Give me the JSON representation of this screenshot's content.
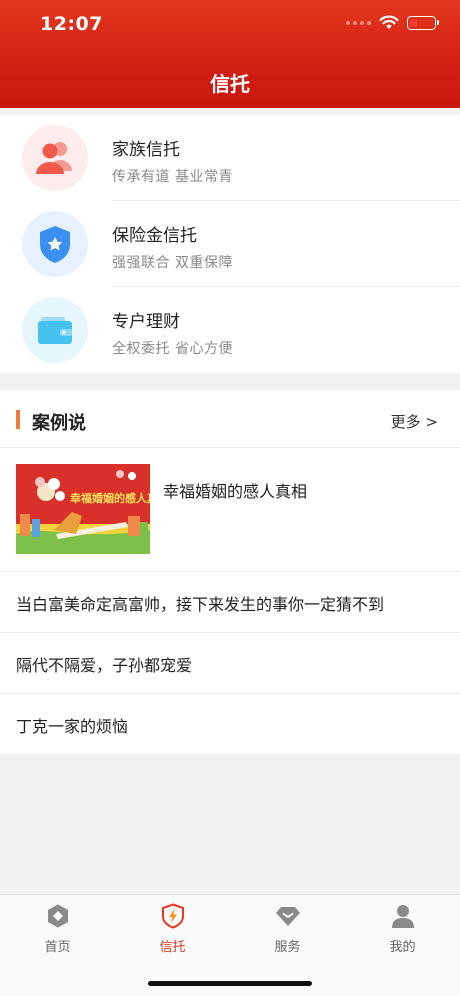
{
  "status_bar": {
    "time": "12:07"
  },
  "header": {
    "title": "信托"
  },
  "products": [
    {
      "name": "家族信托",
      "subtitle": "传承有道  基业常青",
      "icon": "family-icon",
      "color": "#f05a4c"
    },
    {
      "name": "保险金信托",
      "subtitle": "强强联合  双重保障",
      "icon": "shield-star-icon",
      "color": "#3a8ff0"
    },
    {
      "name": "专户理财",
      "subtitle": "全权委托  省心方便",
      "icon": "wallet-icon",
      "color": "#45c2f0"
    }
  ],
  "cases": {
    "title": "案例说",
    "more": "更多 >",
    "featured": {
      "title": "幸福婚姻的感人真相",
      "image_caption": "幸福婚姻的感人真相"
    },
    "items": [
      {
        "title": "当白富美命定高富帅，接下来发生的事你一定猜不到"
      },
      {
        "title": "隔代不隔爱，子孙都宠爱"
      },
      {
        "title": "丁克一家的烦恼"
      }
    ]
  },
  "tabbar": {
    "active_index": 1,
    "active_color": "#e43a22",
    "items": [
      {
        "label": "首页",
        "icon": "home-hexagon-icon"
      },
      {
        "label": "信托",
        "icon": "trust-shield-icon"
      },
      {
        "label": "服务",
        "icon": "diamond-icon"
      },
      {
        "label": "我的",
        "icon": "person-icon"
      }
    ]
  }
}
